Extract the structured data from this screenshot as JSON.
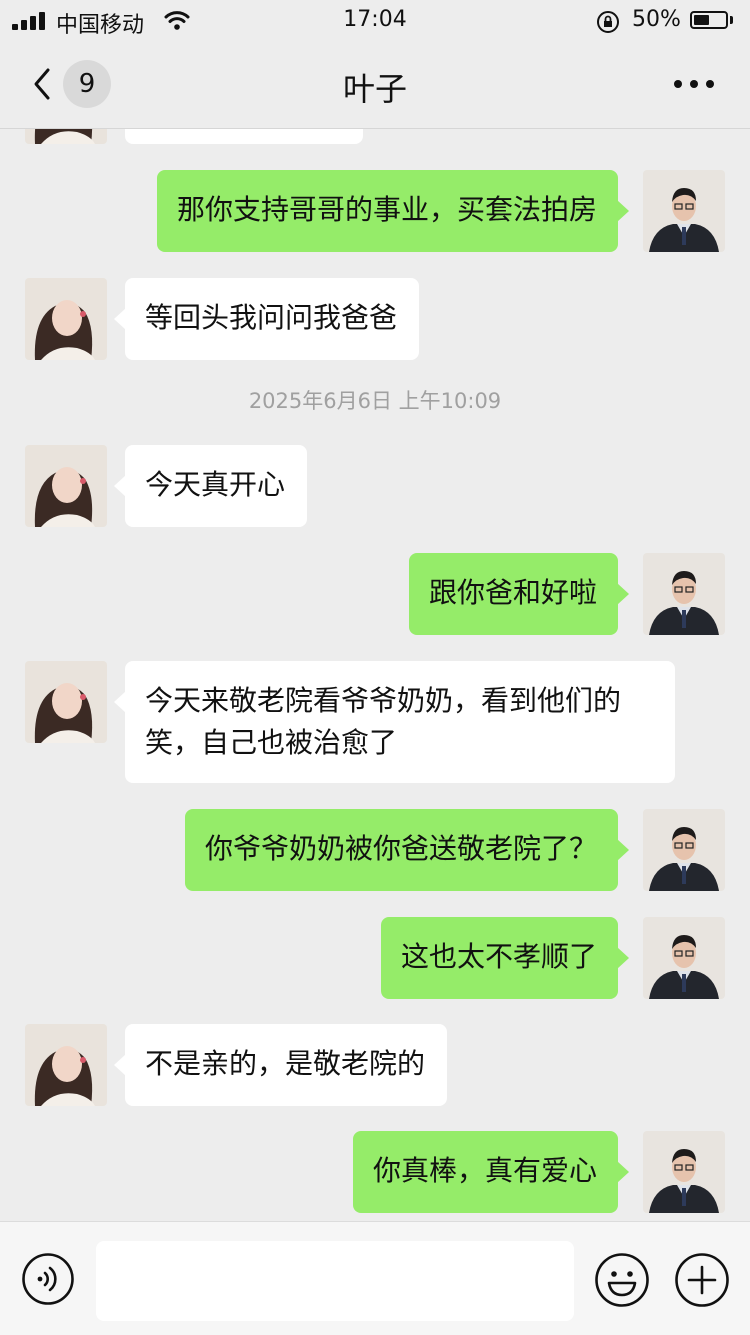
{
  "status_bar": {
    "carrier": "中国移动",
    "time": "17:04",
    "battery_percent": "50%",
    "battery_level": 0.5,
    "icons": [
      "signal-icon",
      "wifi-icon",
      "rotation-lock-icon",
      "battery-icon"
    ]
  },
  "nav": {
    "unread_count": "9",
    "title": "叶子",
    "icons": [
      "back-chevron-icon",
      "more-dots-icon"
    ]
  },
  "messages": [
    {
      "side": "in",
      "text": ""
    },
    {
      "side": "out",
      "text": "那你支持哥哥的事业，买套法拍房"
    },
    {
      "side": "in",
      "text": "等回头我问问我爸爸"
    },
    {
      "side": "out",
      "text": "跟你爸和好啦"
    },
    {
      "side": "in",
      "text": "今天真开心"
    },
    {
      "side": "in",
      "text": "今天来敬老院看爷爷奶奶，看到他们的笑，自己也被治愈了"
    },
    {
      "side": "out",
      "text": "你爷爷奶奶被你爸送敬老院了？"
    },
    {
      "side": "out",
      "text": "这也太不孝顺了"
    },
    {
      "side": "in",
      "text": "不是亲的，是敬老院的"
    },
    {
      "side": "out",
      "text": "你真棒，真有爱心"
    }
  ],
  "timestamp": "2025年6月6日 上午10:09",
  "input_bar": {
    "icons": [
      "voice-icon",
      "emoji-icon",
      "plus-icon"
    ]
  },
  "colors": {
    "background": "#ededed",
    "incoming_bubble": "#ffffff",
    "outgoing_bubble": "#95ec69",
    "timestamp_text": "#a0a0a0"
  }
}
